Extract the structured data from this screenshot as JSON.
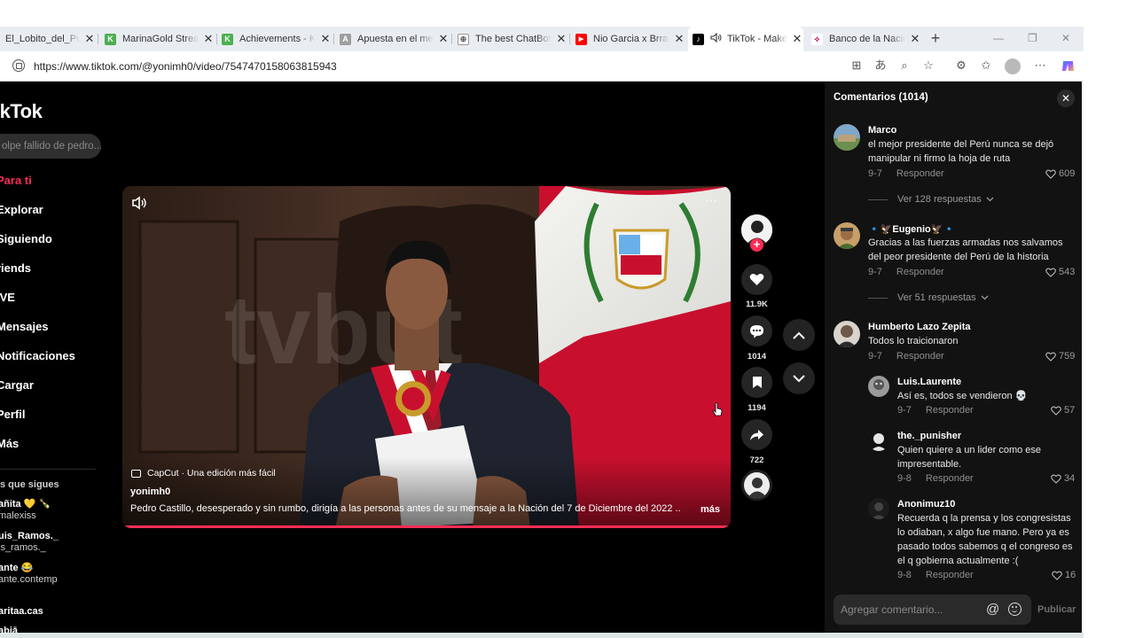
{
  "browser": {
    "tabs": [
      {
        "title": "El_Lobito_del_Pueblo",
        "favicon_color": "#ffffff",
        "favicon_text": ""
      },
      {
        "title": "MarinaGold Stream",
        "favicon_color": "#4caf50",
        "favicon_text": "K"
      },
      {
        "title": "Achievements - Kick",
        "favicon_color": "#4caf50",
        "favicon_text": "K"
      },
      {
        "title": "Apuesta en el mejor",
        "favicon_color": "#9e9e9e",
        "favicon_text": "A"
      },
      {
        "title": "The best ChatBot",
        "favicon_color": "#ffffff",
        "favicon_text": "⊕"
      },
      {
        "title": "Nio Garcia x Brray",
        "favicon_color": "#ff0000",
        "favicon_text": "▶"
      },
      {
        "title": "TikTok - Make Your",
        "favicon_color": "#000000",
        "favicon_text": "♪"
      },
      {
        "title": "Banco de la Nación",
        "favicon_color": "#ffffff",
        "favicon_text": "⟡"
      }
    ],
    "close_glyph": "✕",
    "new_tab": "+",
    "url": "https://www.tiktok.com/@yonimh0/video/7547470158063815943"
  },
  "sidebar": {
    "logo": "ikTok",
    "search_placeholder": "olpe fallido de pedro...",
    "nav": [
      "Para ti",
      "Explorar",
      "Siguiendo",
      "riends",
      "IVE",
      "Mensajes",
      "Notificaciones",
      "Cargar",
      "Perfil",
      "Más"
    ],
    "following_header": "s que sigues",
    "following": [
      {
        "name": "añita 💛 🍾",
        "handle": "malexiss"
      },
      {
        "name": "uis_Ramos._",
        "handle": "is_ramos._"
      },
      {
        "name": "ante 😂",
        "handle": "ante.contemp"
      },
      {
        "name": "aritaa.cas",
        "handle": ""
      },
      {
        "name": "abiā",
        "handle": ""
      }
    ]
  },
  "video": {
    "capcut_label": "CapCut · Una edición más fácil",
    "author": "yonimh0",
    "caption": "Pedro Castillo, desesperado y sin rumbo, dirigía a las personas antes de su mensaje a la Nación del 7 de Diciembre del 2022 ...",
    "more": "más",
    "watermark": "tvbut",
    "progress": 1.0
  },
  "actions": {
    "likes": "11.9K",
    "comments": "1014",
    "saves": "1194",
    "shares": "722"
  },
  "comments_panel": {
    "title": "Comentarios (1014)",
    "reply_label": "Responder",
    "comments": [
      {
        "author": "Marco",
        "text": "el mejor presidente del Perú nunca se dejó manipular ni firmo la hoja de ruta",
        "date": "9-7",
        "likes": "609",
        "more_replies": "Ver 128 respuestas"
      },
      {
        "author": "🔹🦅Eugenio🦅🔹",
        "text": "Gracias a las fuerzas armadas nos salvamos del peor presidente del Perú de la historia",
        "date": "9-7",
        "likes": "543",
        "more_replies": "Ver 51 respuestas"
      },
      {
        "author": "Humberto Lazo Zepita",
        "text": "Todos lo traicionaron",
        "date": "9-7",
        "likes": "759",
        "more_replies": ""
      }
    ],
    "replies": [
      {
        "author": "Luis.Laurente",
        "text": "Así es, todos se vendieron 💀",
        "date": "9-7",
        "likes": "57"
      },
      {
        "author": "the._punisher",
        "text": "Quien quiere a un lider como ese impresentable.",
        "date": "9-8",
        "likes": "34"
      },
      {
        "author": "Anonimuz10",
        "text": "Recuerda q la prensa y los congresistas lo odiaban, x algo fue mano. Pero ya es pasado todos sabemos q el congreso es el q gobierna actualmente :(",
        "date": "9-8",
        "likes": "16"
      }
    ],
    "input_placeholder": "Agregar comentario...",
    "at_symbol": "@",
    "post_label": "Publicar"
  },
  "colors": {
    "accent": "#fe2c55",
    "panel_bg": "#121212",
    "page_bg": "#000000"
  }
}
